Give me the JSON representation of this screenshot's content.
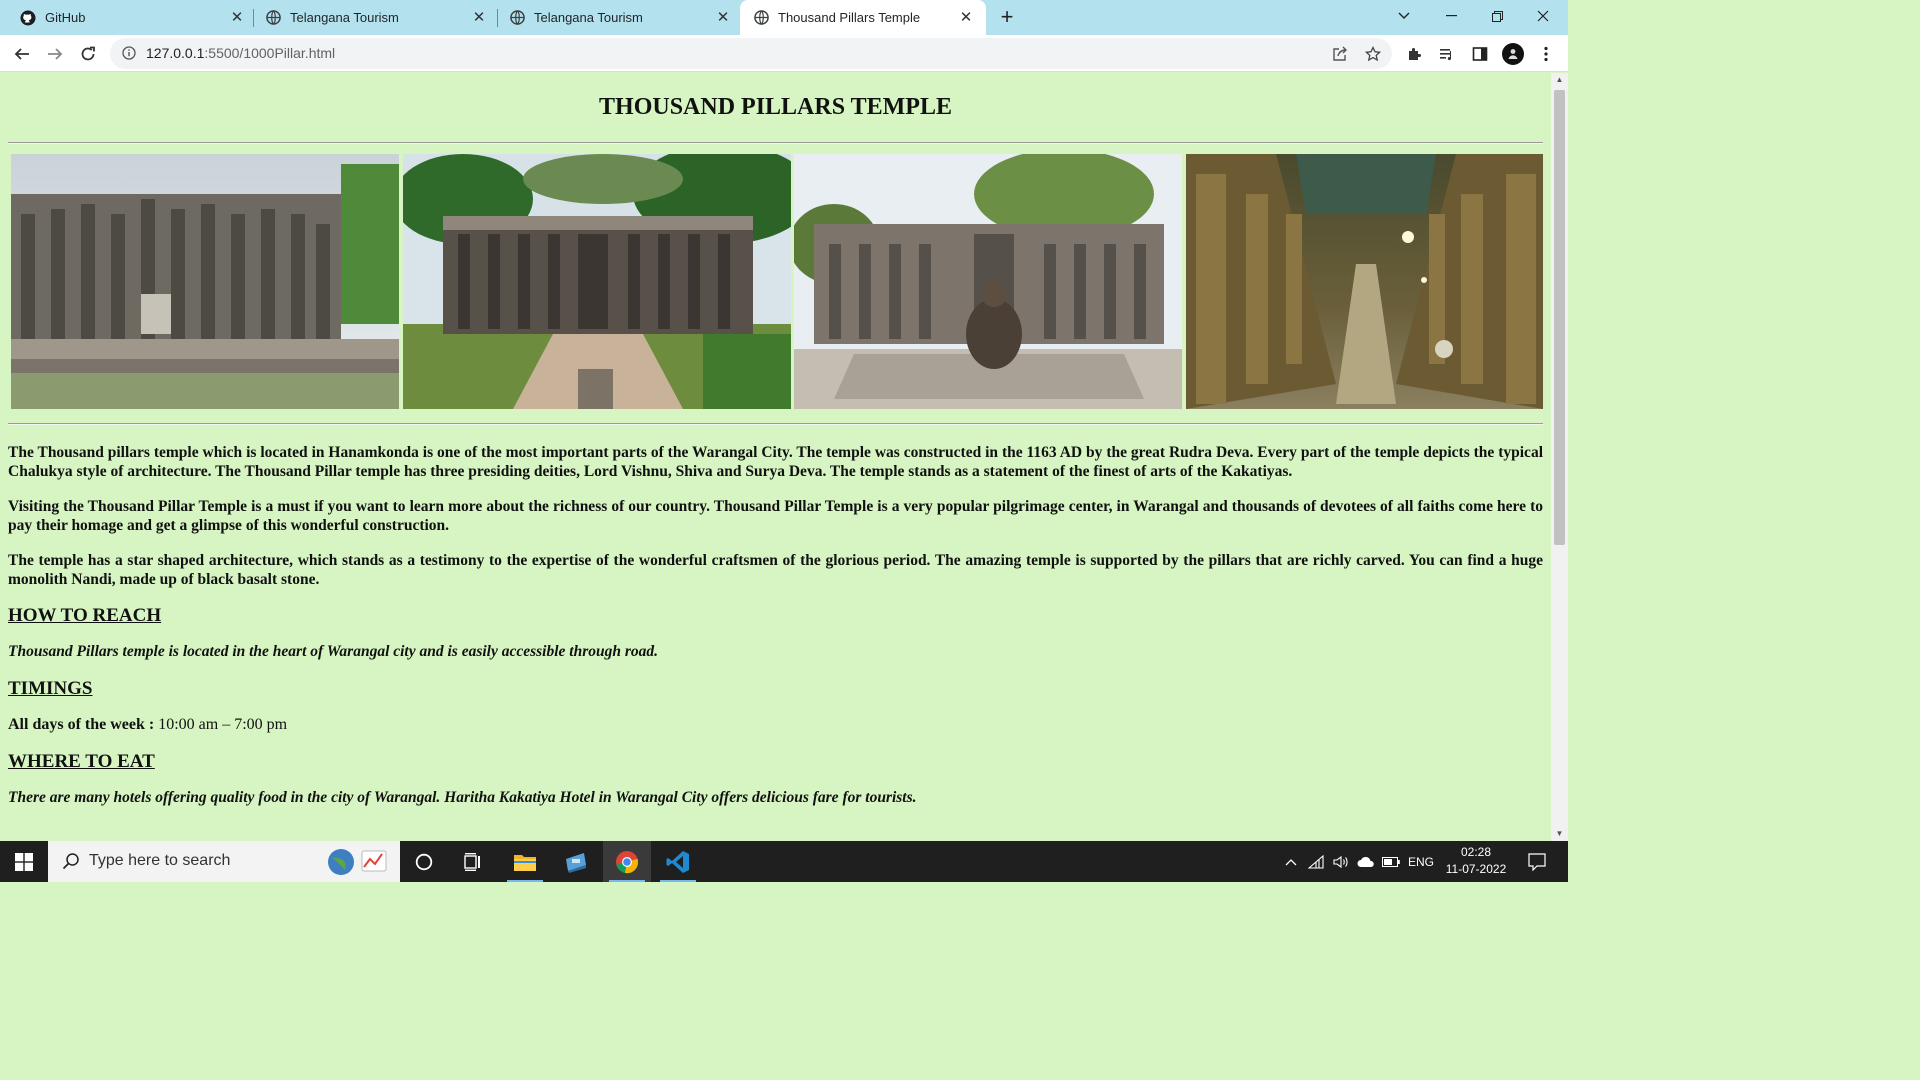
{
  "browser": {
    "tabs": [
      {
        "title": "GitHub",
        "favicon": "github-icon",
        "active": false
      },
      {
        "title": "Telangana Tourism",
        "favicon": "globe-icon",
        "active": false
      },
      {
        "title": "Telangana Tourism",
        "favicon": "globe-icon",
        "active": false
      },
      {
        "title": "Thousand Pillars Temple",
        "favicon": "globe-icon",
        "active": true
      }
    ],
    "new_tab_label": "+",
    "url_host": "127.0.0.1",
    "url_path": ":5500/1000Pillar.html"
  },
  "page": {
    "title": "THOUSAND PILLARS TEMPLE",
    "photos": [
      {
        "alt": "temple-photo-1"
      },
      {
        "alt": "temple-photo-2"
      },
      {
        "alt": "temple-photo-3"
      },
      {
        "alt": "temple-photo-4"
      }
    ],
    "paragraphs": [
      "The Thousand pillars temple which is located in Hanamkonda is one of the most important parts of the Warangal City. The temple was constructed in the 1163 AD by the great Rudra Deva. Every part of the temple depicts the typical Chalukya style of architecture. The Thousand Pillar temple has three presiding deities, Lord Vishnu, Shiva and Surya Deva. The temple stands as a statement of the finest of arts of the Kakatiyas.",
      "Visiting the Thousand Pillar Temple is a must if you want to learn more about the richness of our country. Thousand Pillar Temple is a very popular pilgrimage center, in Warangal and thousands of devotees of all faiths come here to pay their homage and get a glimpse of this wonderful construction.",
      "The temple has a star shaped architecture, which stands as a testimony to the expertise of the wonderful craftsmen of the glorious period. The amazing temple is supported by the pillars that are richly carved. You can find a huge monolith Nandi, made up of black basalt stone."
    ],
    "how_to_reach": {
      "heading": "HOW TO REACH",
      "text": "Thousand Pillars temple is located in the heart of Warangal city and is easily accessible through road."
    },
    "timings": {
      "heading": "TIMINGS",
      "label": "All days of the week :",
      "value": "10:00 am – 7:00 pm"
    },
    "where_to_eat": {
      "heading": "WHERE TO EAT",
      "text": "There are many hotels offering quality food in the city of Warangal. Haritha Kakatiya Hotel in Warangal City offers delicious fare for tourists."
    }
  },
  "taskbar": {
    "search_placeholder": "Type here to search",
    "language": "ENG",
    "time": "02:28",
    "date": "11-07-2022"
  },
  "colors": {
    "page_background": "#d6f5c2",
    "tabstrip": "#b3e2ee",
    "taskbar": "#1f1f1f"
  }
}
